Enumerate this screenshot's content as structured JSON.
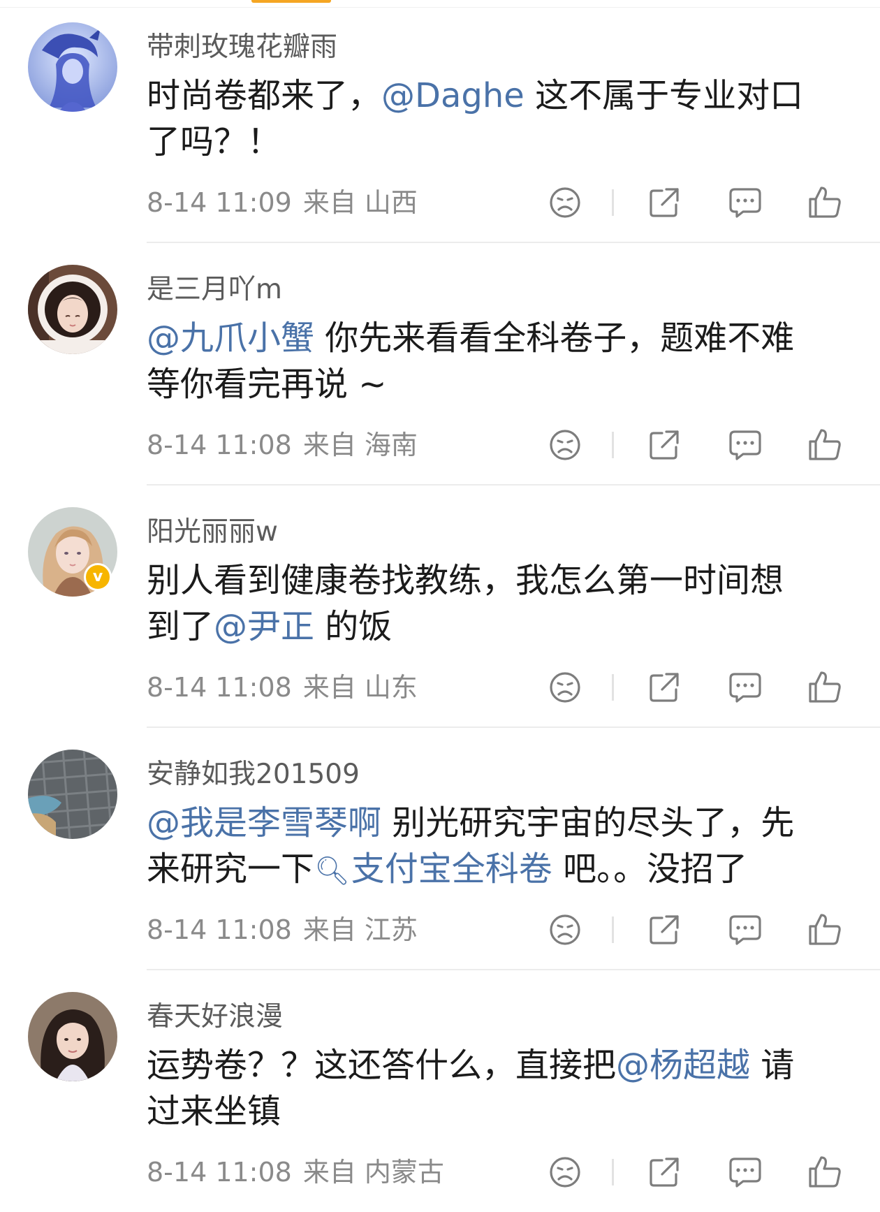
{
  "colors": {
    "mention": "#4a72a8",
    "meta_text": "#8a8a8a",
    "username_text": "#5b5b5b",
    "body_text": "#1b1b1b",
    "verified_badge": "#f7b500",
    "top_tab_indicator": "#f5a623"
  },
  "verified_badge_glyph": "v",
  "comments": [
    {
      "username": "带刺玫瑰花瓣雨",
      "line1": [
        {
          "type": "text",
          "text": "时尚卷都来了，"
        },
        {
          "type": "mention",
          "text": "@Daghe"
        },
        {
          "type": "text",
          "text": " 这不属于专业对口"
        }
      ],
      "line2": [
        {
          "type": "text",
          "text": "了吗？！"
        }
      ],
      "time": "8-14 11:09",
      "location": "来自 山西",
      "verified": false,
      "avatar_icon": "blue-dragon-girl-avatar"
    },
    {
      "username": "是三月吖m",
      "line1": [
        {
          "type": "mention",
          "text": "@九爪小蟹"
        },
        {
          "type": "text",
          "text": " 你先来看看全科卷子，题难不难"
        }
      ],
      "line2": [
        {
          "type": "text",
          "text": "等你看完再说 ~"
        }
      ],
      "time": "8-14 11:08",
      "location": "来自 海南",
      "verified": false,
      "avatar_icon": "girl-white-hood-avatar"
    },
    {
      "username": "阳光丽丽w",
      "line1": [
        {
          "type": "text",
          "text": "别人看到健康卷找教练，我怎么第一时间想"
        }
      ],
      "line2": [
        {
          "type": "text",
          "text": "到了"
        },
        {
          "type": "mention",
          "text": "@尹正"
        },
        {
          "type": "text",
          "text": " 的饭"
        }
      ],
      "time": "8-14 11:08",
      "location": "来自 山东",
      "verified": true,
      "avatar_icon": "illustrated-girl-braid-avatar"
    },
    {
      "username": "安静如我201509",
      "line1": [
        {
          "type": "mention",
          "text": "@我是李雪琴啊"
        },
        {
          "type": "text",
          "text": " 别光研究宇宙的尽头了，先"
        }
      ],
      "line2": [
        {
          "type": "text",
          "text": "来研究一下"
        },
        {
          "type": "topic",
          "text": "支付宝全科卷"
        },
        {
          "type": "text",
          "text": " 吧。。没招了"
        }
      ],
      "time": "8-14 11:08",
      "location": "来自 江苏",
      "verified": false,
      "avatar_icon": "stone-street-photo-avatar"
    },
    {
      "username": "春天好浪漫",
      "line1": [
        {
          "type": "text",
          "text": "运势卷？？这还答什么，直接把"
        },
        {
          "type": "mention",
          "text": "@杨超越"
        },
        {
          "type": "text",
          "text": " 请"
        }
      ],
      "line2": [
        {
          "type": "text",
          "text": "过来坐镇"
        }
      ],
      "time": "8-14 11:08",
      "location": "来自 内蒙古",
      "verified": false,
      "avatar_icon": "dark-hair-girl-avatar"
    }
  ]
}
